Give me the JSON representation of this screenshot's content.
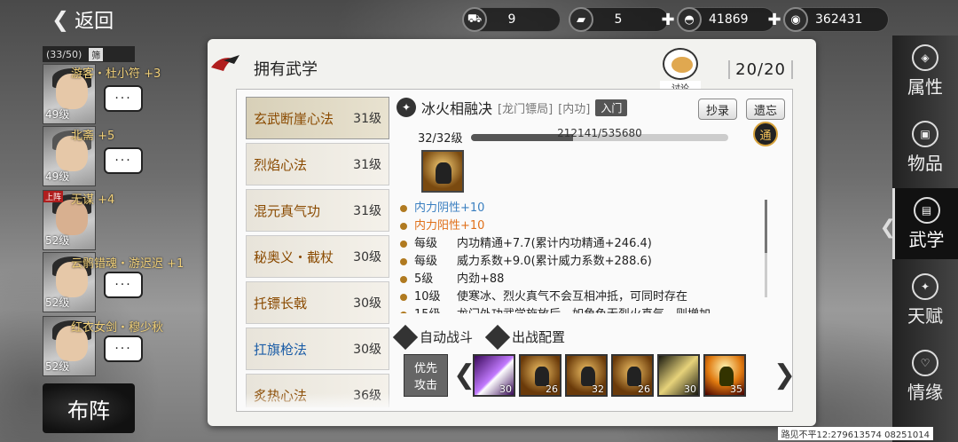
{
  "back_label": "返回",
  "currencies": [
    {
      "icon": "cart-icon",
      "glyph": "⛟",
      "value": "9",
      "plus": false
    },
    {
      "icon": "gold-bar-icon",
      "glyph": "▰",
      "value": "5",
      "plus": true
    },
    {
      "icon": "silver-ingot-icon",
      "glyph": "◓",
      "value": "41869",
      "plus": true
    },
    {
      "icon": "coin-icon",
      "glyph": "◉",
      "value": "362431",
      "plus": false
    }
  ],
  "party": {
    "count": "(33/50)",
    "filter_label": "筛",
    "members": [
      {
        "name": "游客・杜小符",
        "bonus": "+3",
        "level": "49级",
        "badge": ""
      },
      {
        "name": "北斋",
        "bonus": "+5",
        "level": "49级",
        "badge": ""
      },
      {
        "name": "无谋",
        "bonus": "+4",
        "level": "52级",
        "badge": "上阵"
      },
      {
        "name": "云鹘错魂・游迟迟",
        "bonus": "+1",
        "level": "52级",
        "badge": ""
      },
      {
        "name": "红衣女剑・穆少秋",
        "bonus": "",
        "level": "52级",
        "badge": ""
      }
    ],
    "chat_glyph": "···"
  },
  "formation_label": "布阵",
  "panel": {
    "title": "拥有武学",
    "discuss_label": "讨论",
    "counter": "20/20"
  },
  "skills": [
    {
      "name": "玄武断崖心法",
      "level": "31级",
      "color": "orange"
    },
    {
      "name": "烈焰心法",
      "level": "31级",
      "color": "orange"
    },
    {
      "name": "混元真气功",
      "level": "31级",
      "color": "orange"
    },
    {
      "name": "秘奥义・截杖",
      "level": "30级",
      "color": "orange"
    },
    {
      "name": "托镖长戟",
      "level": "30级",
      "color": "orange"
    },
    {
      "name": "扛旗枪法",
      "level": "30级",
      "color": "blue"
    },
    {
      "name": "炙热心法",
      "level": "36级",
      "color": "orange"
    }
  ],
  "detail": {
    "name": "冰火相融决",
    "sect": "[龙门镖局]",
    "type": "[内功]",
    "rudoor": "入门",
    "copy_label": "抄录",
    "legacy_label": "遗忘",
    "level": "32/32级",
    "exp_text": "212141/535680",
    "exp_progress": 0.396,
    "tong_label": "通",
    "effects": [
      {
        "key": "",
        "text": "内力阴性+10",
        "color": "blue"
      },
      {
        "key": "",
        "text": "内力阳性+10",
        "color": "orange"
      },
      {
        "key": "每级",
        "text": "内功精通+7.7(累计内功精通+246.4)",
        "color": ""
      },
      {
        "key": "每级",
        "text": "威力系数+9.0(累计威力系数+288.6)",
        "color": ""
      },
      {
        "key": "5级",
        "text": "内劲+88",
        "color": ""
      },
      {
        "key": "10级",
        "text": "使寒冰、烈火真气不会互相冲抵，可同时存在",
        "color": ""
      },
      {
        "key": "15级",
        "text": "龙门外功武学施放后，如角色无烈火真气，则增加",
        "color": ""
      }
    ],
    "auto_battle_label": "自动战斗",
    "deploy_label": "出战配置",
    "priority_label_1": "优先",
    "priority_label_2": "攻击",
    "slots": [
      {
        "style": "purple",
        "num": "30"
      },
      {
        "style": "normal",
        "num": "26"
      },
      {
        "style": "normal",
        "num": "32"
      },
      {
        "style": "normal",
        "num": "26"
      },
      {
        "style": "gold",
        "num": "30"
      },
      {
        "style": "fire",
        "num": "35"
      }
    ]
  },
  "right_menu": [
    {
      "label": "属性",
      "icon": "attribute-icon",
      "glyph": "◈"
    },
    {
      "label": "物品",
      "icon": "item-box-icon",
      "glyph": "▣"
    },
    {
      "label": "武学",
      "icon": "martial-book-icon",
      "glyph": "▤",
      "active": true
    },
    {
      "label": "天赋",
      "icon": "talent-icon",
      "glyph": "✦"
    },
    {
      "label": "情缘",
      "icon": "heart-icon",
      "glyph": "♡"
    }
  ],
  "footer_text": "路见不平12:279613574 08251014"
}
